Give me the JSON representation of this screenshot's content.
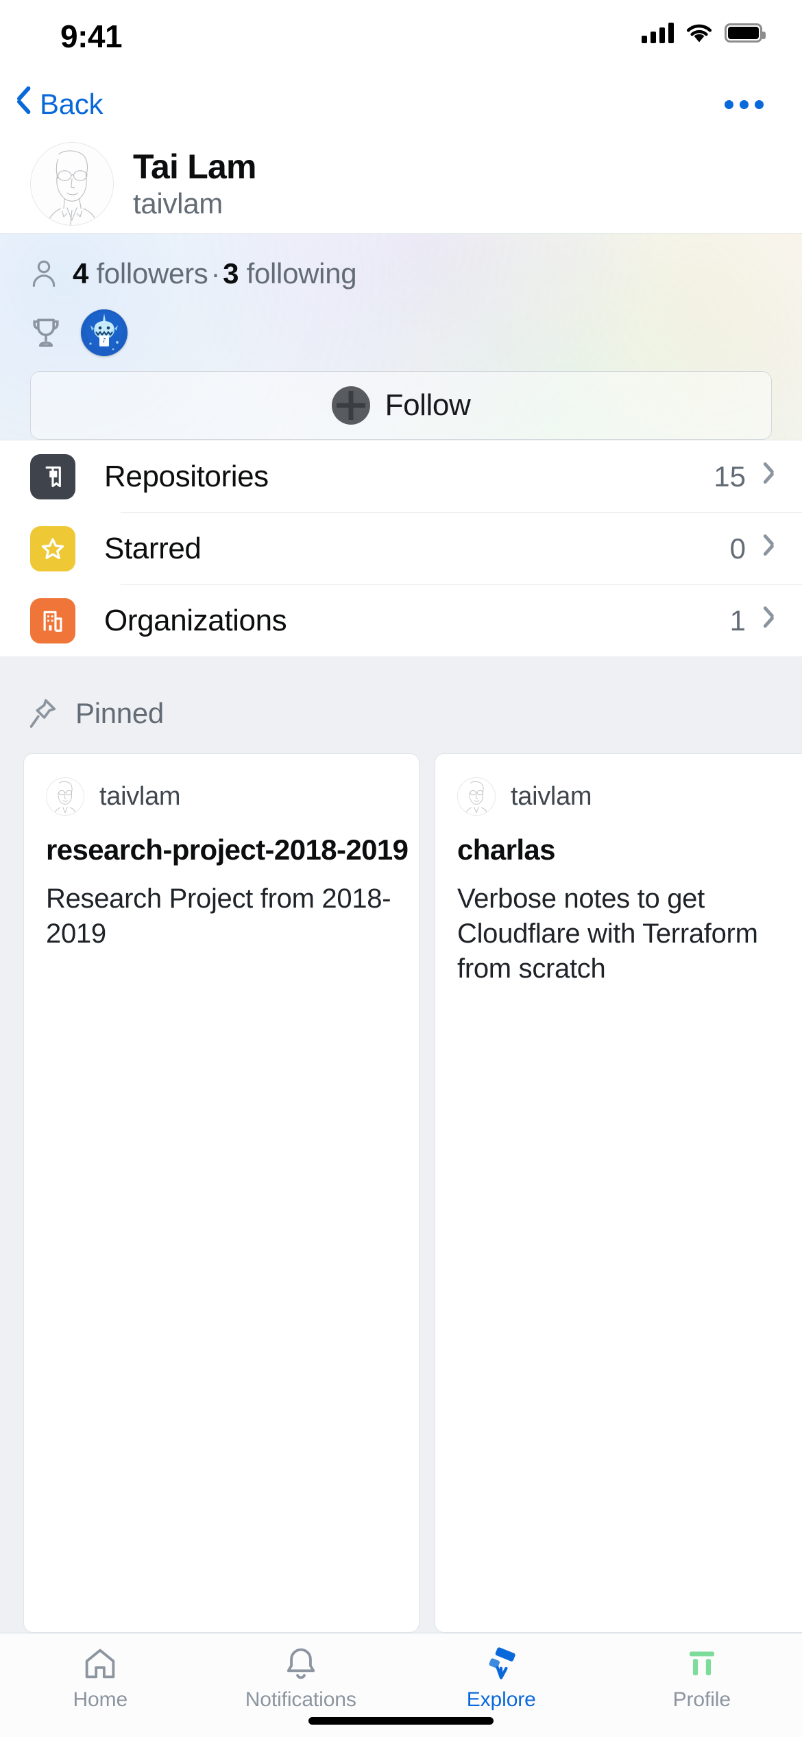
{
  "status_bar": {
    "time": "9:41",
    "signal_icon": "cellular-signal-icon",
    "wifi_icon": "wifi-icon",
    "battery_icon": "battery-icon"
  },
  "nav": {
    "back_label": "Back",
    "back_icon": "chevron-left-icon",
    "more_icon": "ellipsis-icon"
  },
  "profile": {
    "avatar_icon": "user-avatar-sketch",
    "display_name": "Tai Lam",
    "login": "taivlam"
  },
  "stats": {
    "person_icon": "person-icon",
    "followers_count": "4",
    "followers_label": "followers",
    "separator": "·",
    "following_count": "3",
    "following_label": "following",
    "trophy_icon": "trophy-icon",
    "achievement_badge_icon": "pull-shark-badge",
    "follow_button_label": "Follow",
    "follow_button_icon": "person-add-icon"
  },
  "lists": [
    {
      "label": "Repositories",
      "count": "15",
      "icon": "repo-book-icon",
      "color": "#3f434b",
      "chevron": "chevron-right-icon"
    },
    {
      "label": "Starred",
      "count": "0",
      "icon": "star-icon",
      "color": "#efc836",
      "chevron": "chevron-right-icon"
    },
    {
      "label": "Organizations",
      "count": "1",
      "icon": "building-icon",
      "color": "#ef7538",
      "chevron": "chevron-right-icon"
    }
  ],
  "pinned": {
    "icon": "pin-icon",
    "title": "Pinned",
    "cards": [
      {
        "owner": "taivlam",
        "owner_avatar_icon": "user-avatar-sketch",
        "name": "research-project-2018-2019",
        "description": "Research Project from 2018-2019"
      },
      {
        "owner": "taivlam",
        "owner_avatar_icon": "user-avatar-sketch",
        "name": "charlas",
        "description": "Verbose notes to get Cloudflare with Terraform from scratch"
      }
    ]
  },
  "tab_bar": {
    "tabs": [
      {
        "label": "Home",
        "icon": "home-icon",
        "active": false
      },
      {
        "label": "Notifications",
        "icon": "bell-icon",
        "active": false
      },
      {
        "label": "Explore",
        "icon": "telescope-icon",
        "active": true
      },
      {
        "label": "Profile",
        "icon": "profile-icon",
        "active": false
      }
    ],
    "accent_color": "#0a69da",
    "inactive_color": "#8c959f"
  }
}
